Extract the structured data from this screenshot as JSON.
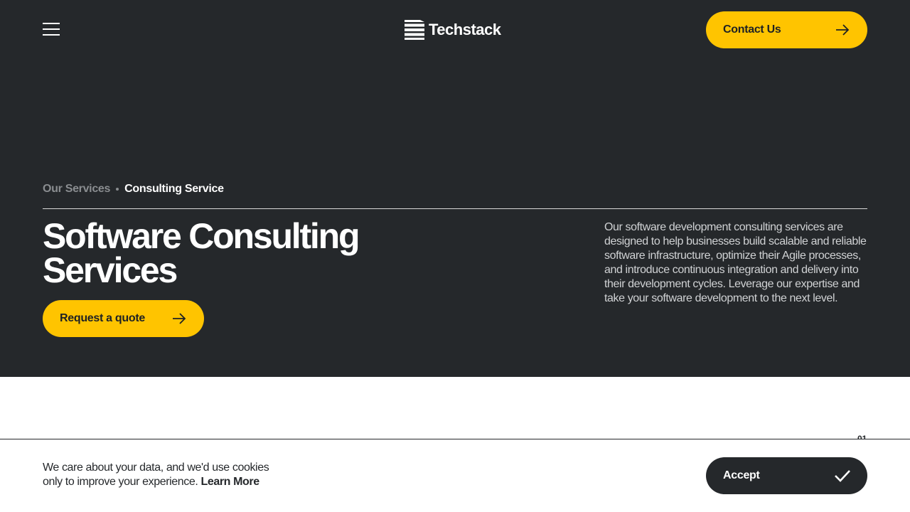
{
  "header": {
    "logo_text": "Techstack",
    "contact_label": "Contact Us"
  },
  "breadcrumb": {
    "parent": "Our Services",
    "current": "Consulting Service"
  },
  "hero": {
    "title": "Software Consulting Services",
    "cta_label": "Request a quote",
    "description": "Our software development consulting services are designed to help businesses build scalable and reliable software infrastructure, optimize their Agile processes, and introduce continuous integration and delivery into their development cycles. Leverage our expertise and take your software development to the next level."
  },
  "section": {
    "number": "01"
  },
  "cookie": {
    "text": "We care about your data, and we'd use cookies only to improve your experience.",
    "link_label": "Learn More",
    "accept_label": "Accept"
  },
  "colors": {
    "hero_bg": "#25282b",
    "accent": "#ffc400",
    "text_light": "#ffffff",
    "muted": "#8a8d90"
  },
  "icons": {
    "menu": "hamburger-icon",
    "arrow": "arrow-right-icon",
    "check": "checkmark-icon",
    "logo": "stacked-bars-logo"
  }
}
